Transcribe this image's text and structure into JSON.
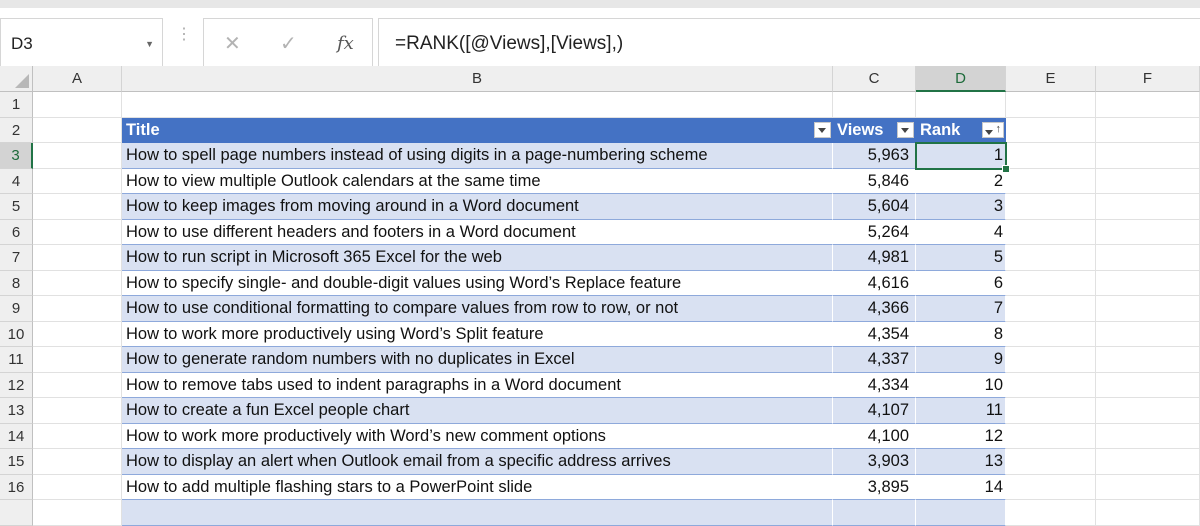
{
  "name_box": {
    "value": "D3"
  },
  "formula_bar": {
    "fx_label": "fx",
    "formula": "=RANK([@Views],[Views],)"
  },
  "columns": [
    "A",
    "B",
    "C",
    "D",
    "E",
    "F"
  ],
  "table": {
    "headers": {
      "title": "Title",
      "views": "Views",
      "rank": "Rank"
    },
    "rows": [
      {
        "row": "3",
        "title": "How to spell page numbers instead of using digits in a page-numbering scheme",
        "views": "5,963",
        "rank": "1"
      },
      {
        "row": "4",
        "title": "How to view multiple Outlook calendars at the same time",
        "views": "5,846",
        "rank": "2"
      },
      {
        "row": "5",
        "title": "How to keep images from moving around in a Word document",
        "views": "5,604",
        "rank": "3"
      },
      {
        "row": "6",
        "title": "How to use different headers and footers in a Word document",
        "views": "5,264",
        "rank": "4"
      },
      {
        "row": "7",
        "title": "How to run script in Microsoft 365 Excel for the web",
        "views": "4,981",
        "rank": "5"
      },
      {
        "row": "8",
        "title": "How to specify single- and double-digit values using Word’s Replace feature",
        "views": "4,616",
        "rank": "6"
      },
      {
        "row": "9",
        "title": "How to use conditional formatting to compare values from row to row, or not",
        "views": "4,366",
        "rank": "7"
      },
      {
        "row": "10",
        "title": "How to work more productively using Word’s Split feature",
        "views": "4,354",
        "rank": "8"
      },
      {
        "row": "11",
        "title": "How to generate random numbers with no duplicates in Excel",
        "views": "4,337",
        "rank": "9"
      },
      {
        "row": "12",
        "title": "How to remove tabs used to indent paragraphs in a Word document",
        "views": "4,334",
        "rank": "10"
      },
      {
        "row": "13",
        "title": "How to create a fun Excel people chart",
        "views": "4,107",
        "rank": "11"
      },
      {
        "row": "14",
        "title": "How to work more productively with Word’s new comment options",
        "views": "4,100",
        "rank": "12"
      },
      {
        "row": "15",
        "title": "How to display an alert when Outlook email from a specific address arrives",
        "views": "3,903",
        "rank": "13"
      },
      {
        "row": "16",
        "title": "How to add multiple flashing stars to a PowerPoint slide",
        "views": "3,895",
        "rank": "14"
      }
    ]
  },
  "row_headers_extra": [
    "1",
    "2"
  ],
  "colors": {
    "table_header": "#4472c4",
    "band": "#d9e1f2",
    "selection": "#217346"
  }
}
